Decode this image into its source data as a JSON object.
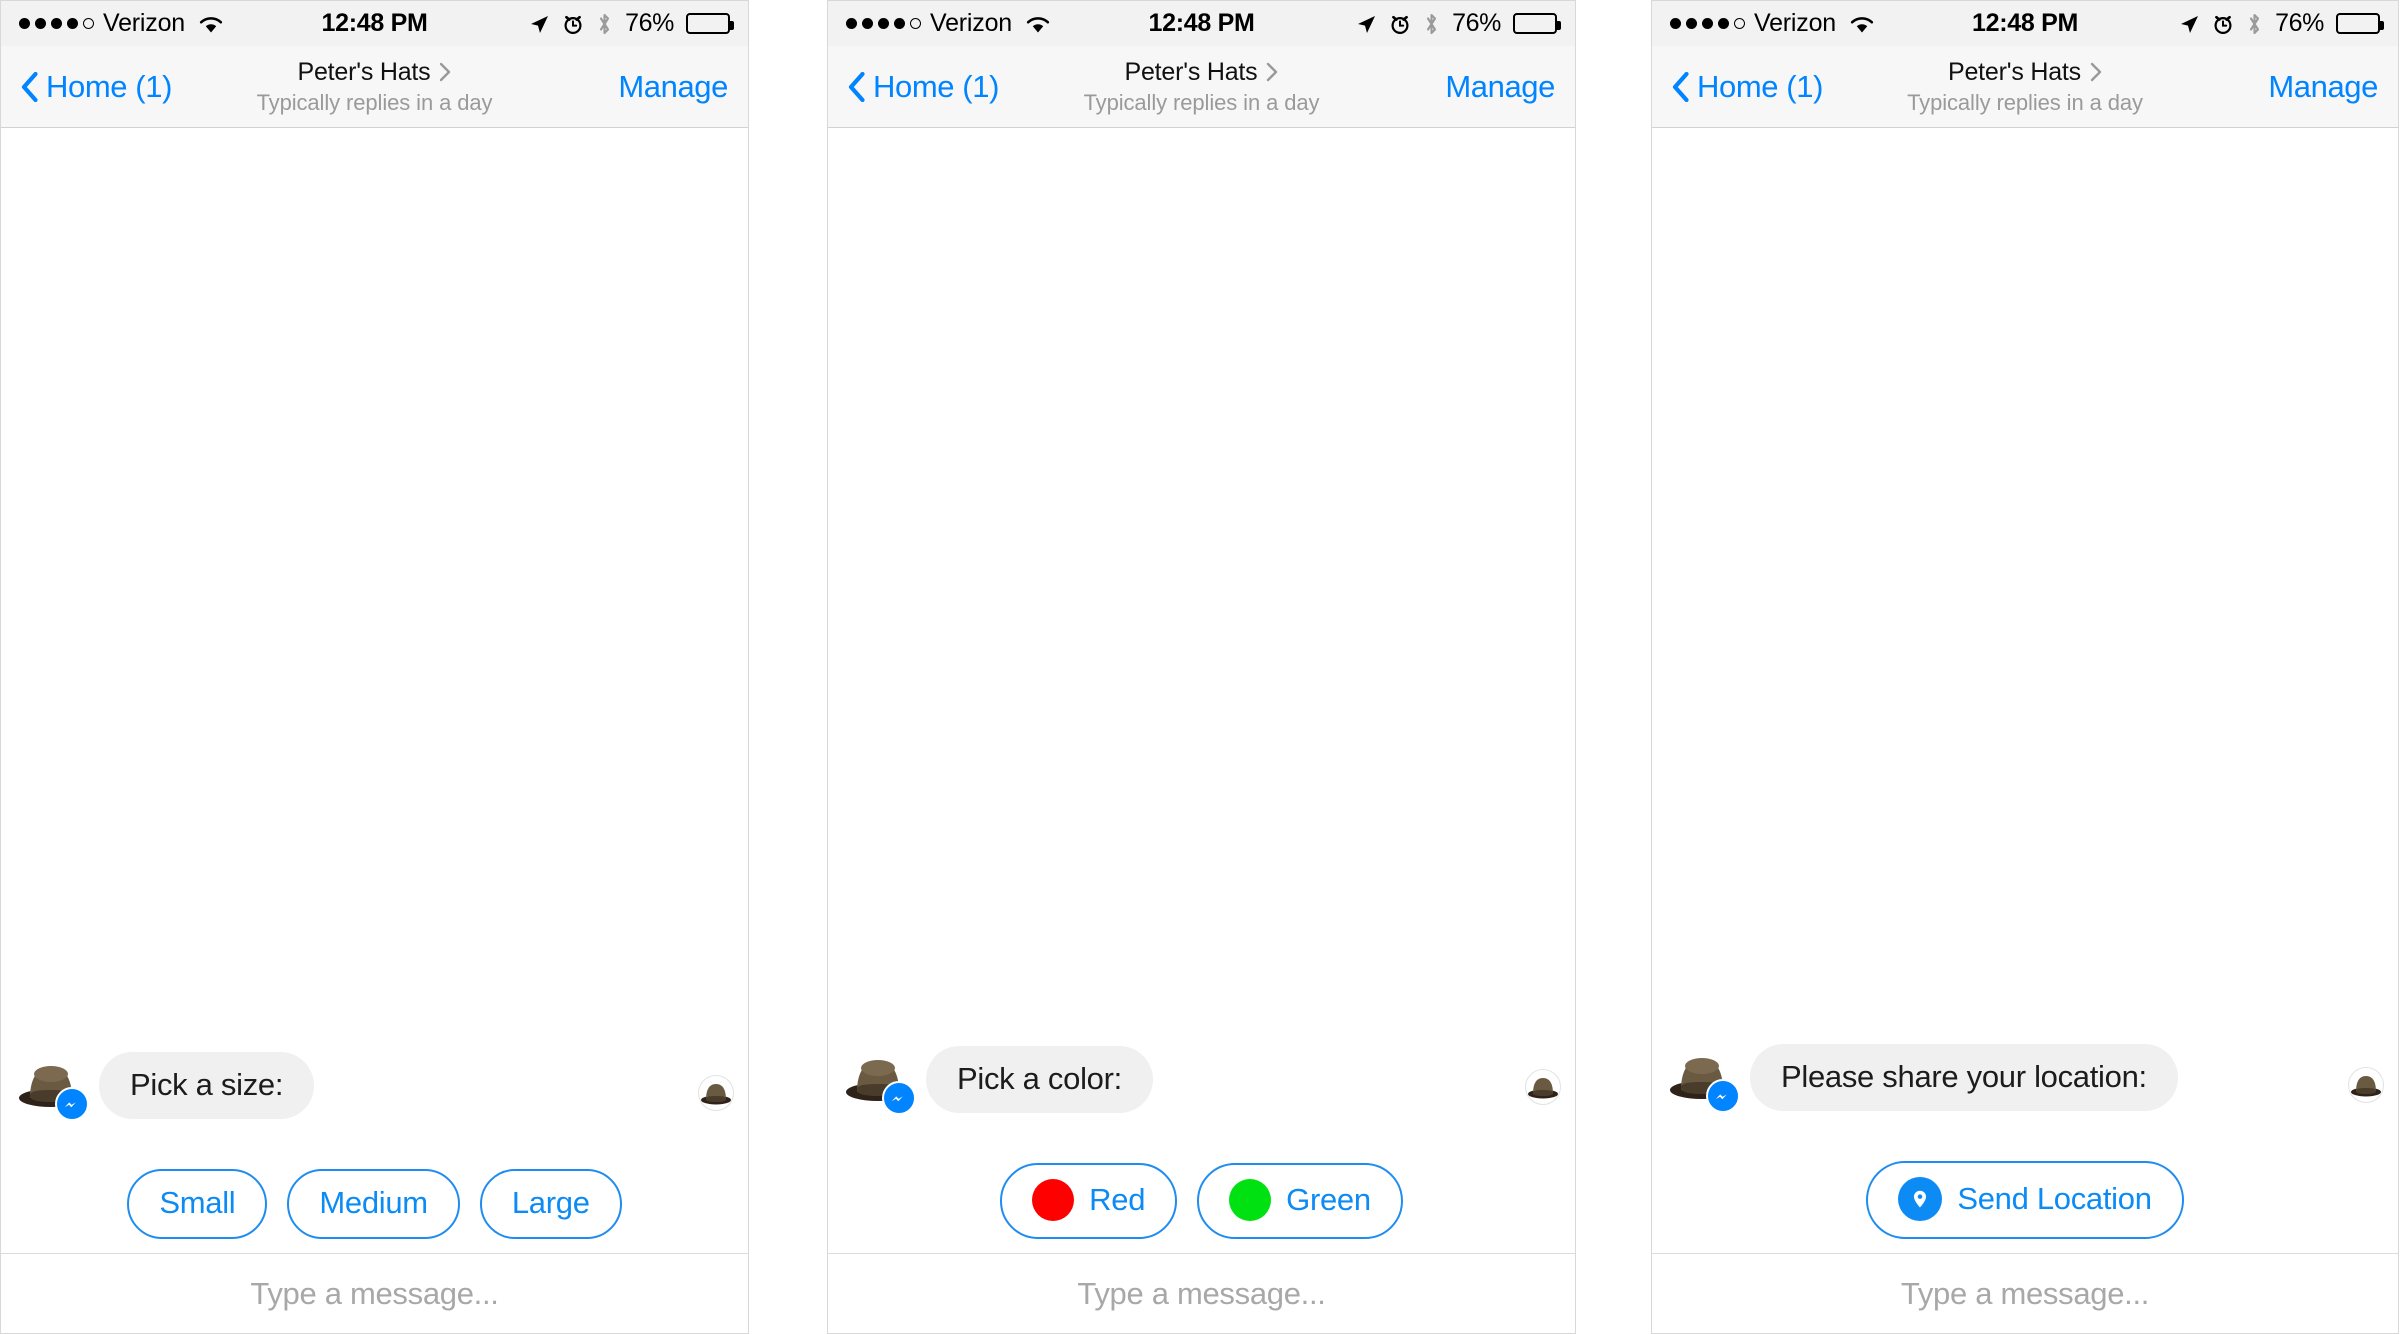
{
  "status_bar": {
    "signal_dots_filled": 4,
    "signal_dots_total": 5,
    "carrier": "Verizon",
    "wifi_icon": "wifi-icon",
    "time": "12:48 PM",
    "location_icon": "location-arrow-icon",
    "alarm_icon": "alarm-clock-icon",
    "bluetooth_icon": "bluetooth-icon",
    "battery_percent": "76%",
    "battery_level": 76
  },
  "nav_bar": {
    "back_icon": "chevron-left-icon",
    "back_label": "Home (1)",
    "title": "Peter's Hats",
    "title_chevron_icon": "chevron-right-icon",
    "subtitle": "Typically replies in a day",
    "right_action": "Manage"
  },
  "composer": {
    "placeholder": "Type a message..."
  },
  "colors": {
    "accent_blue": "#0084ff",
    "quick_reply_blue": "#0d8bf5",
    "bubble_gray": "#f0f0f0",
    "status_bar_gray": "#f2f2f2",
    "nav_bar_gray": "#f7f7f7",
    "swatch_red": "#FF0000",
    "swatch_green": "#00E112"
  },
  "panels": [
    {
      "id": "panel-size",
      "avatar_icon": "bowler-hat-avatar",
      "badge_icon": "messenger-badge-icon",
      "message": "Pick a size:",
      "seen_avatar_icon": "bowler-hat-seen-avatar",
      "quick_replies": [
        {
          "label": "Small",
          "icon": null
        },
        {
          "label": "Medium",
          "icon": null
        },
        {
          "label": "Large",
          "icon": null
        }
      ]
    },
    {
      "id": "panel-color",
      "avatar_icon": "bowler-hat-avatar",
      "badge_icon": "messenger-badge-icon",
      "message": "Pick a color:",
      "seen_avatar_icon": "bowler-hat-seen-avatar",
      "quick_replies": [
        {
          "label": "Red",
          "icon": "color-swatch-red",
          "swatch": "#FF0000"
        },
        {
          "label": "Green",
          "icon": "color-swatch-green",
          "swatch": "#00E112"
        }
      ]
    },
    {
      "id": "panel-location",
      "avatar_icon": "bowler-hat-avatar",
      "badge_icon": "messenger-badge-icon",
      "message": "Please share your location:",
      "seen_avatar_icon": "bowler-hat-seen-avatar",
      "quick_replies": [
        {
          "label": "Send Location",
          "icon": "map-pin-icon"
        }
      ]
    }
  ]
}
